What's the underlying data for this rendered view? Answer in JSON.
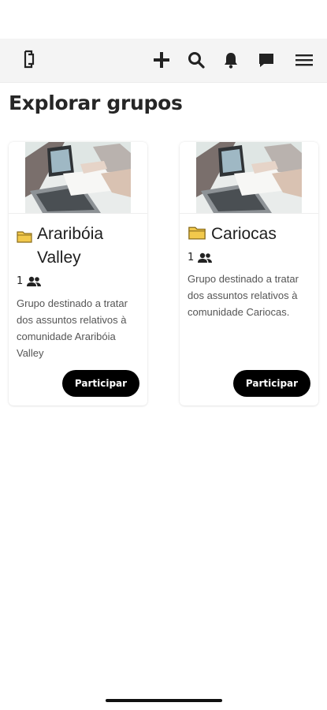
{
  "header": {
    "icons": [
      "logo-icon",
      "plus-icon",
      "search-icon",
      "bell-icon",
      "chat-icon",
      "menu-icon"
    ]
  },
  "page": {
    "title": "Explorar grupos"
  },
  "groups": [
    {
      "name": "Araribóia Valley",
      "members": "1",
      "description": "Grupo destinado a tratar dos assuntos relativos à comunidade Araribóia Valley",
      "button_label": "Participar"
    },
    {
      "name": "Cariocas",
      "members": "1",
      "description": "Grupo destinado a tratar dos assuntos relativos à comunidade Cariocas.",
      "button_label": "Participar"
    }
  ],
  "colors": {
    "button_bg": "#000000",
    "folder": "#f2c94c",
    "topbar_bg": "#f4f4f4"
  }
}
